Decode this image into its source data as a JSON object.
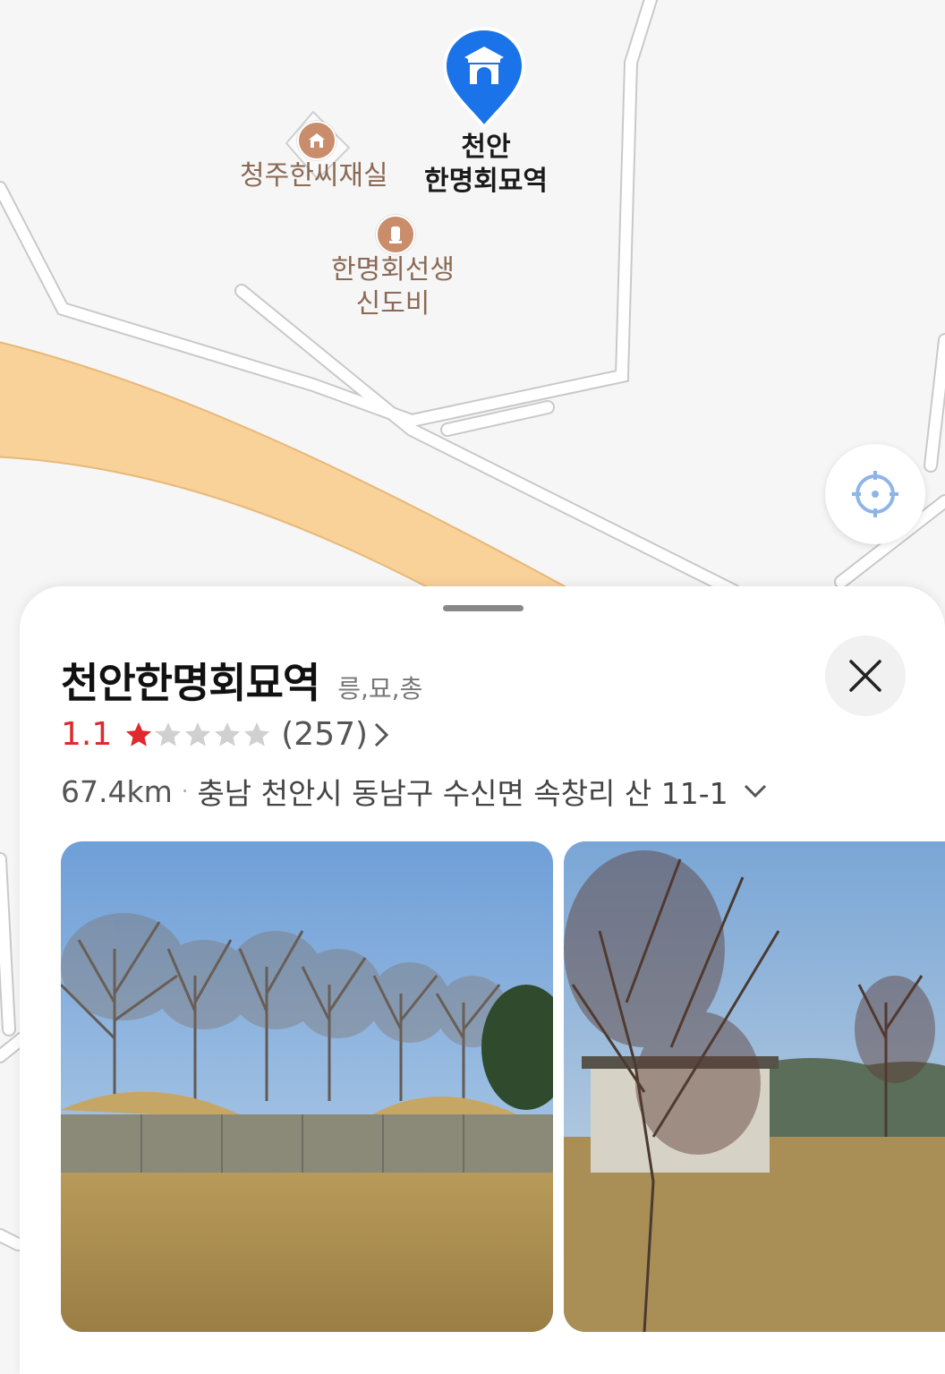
{
  "map": {
    "selected_poi": {
      "name_line1": "천안",
      "name_line2": "한명회묘역",
      "icon": "palace-gate-icon",
      "color": "#1a73e8"
    },
    "pois": [
      {
        "name": "청주한씨재실",
        "icon": "house-icon"
      },
      {
        "name_line1": "한명회선생",
        "name_line2": "신도비",
        "icon": "monument-icon"
      }
    ],
    "locate_button_icon": "crosshair-icon"
  },
  "sheet": {
    "title": "천안한명회묘역",
    "category": "릉,묘,총",
    "rating": "1.1",
    "rating_value": 1.1,
    "max_stars": 5,
    "review_count": "(257)",
    "distance": "67.4km",
    "separator": "·",
    "address": "충남 천안시 동남구 수신면 속창리 산 11-1",
    "close_icon": "close-icon",
    "rating_color": "#e0282d"
  }
}
